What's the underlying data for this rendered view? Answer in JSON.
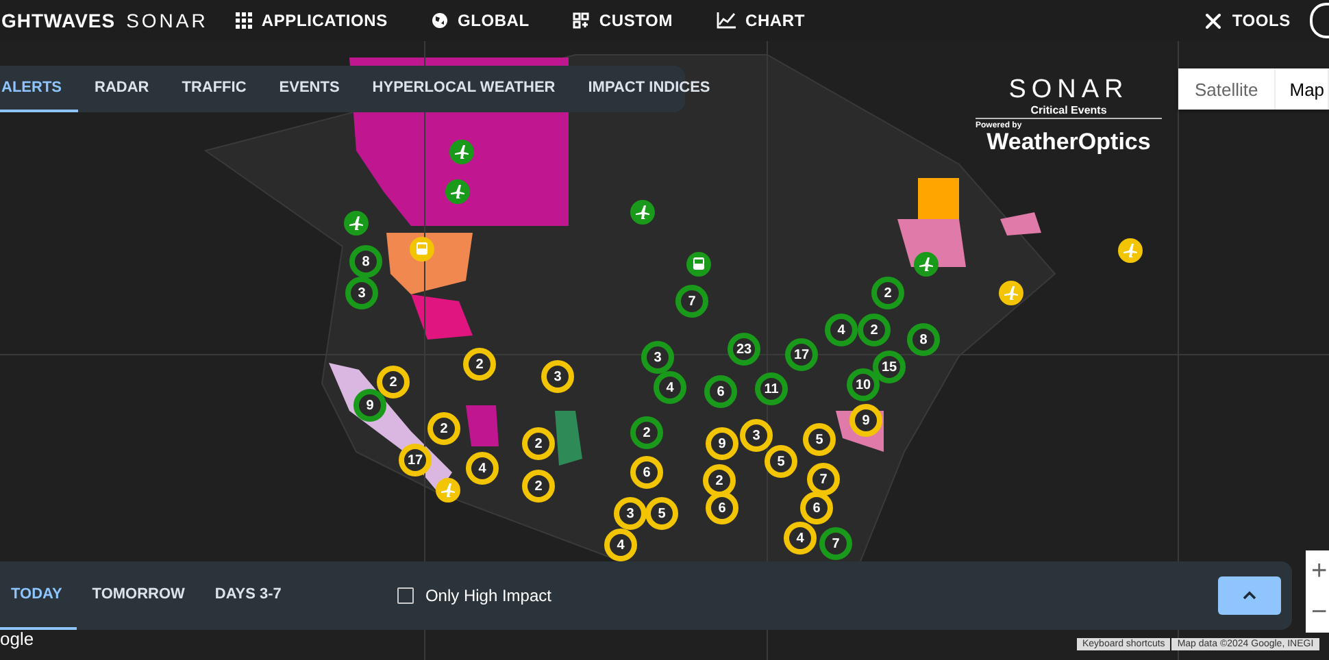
{
  "brand": {
    "name": "GHTWAVES",
    "product": "SONAR"
  },
  "nav": [
    {
      "label": "APPLICATIONS"
    },
    {
      "label": "GLOBAL"
    },
    {
      "label": "CUSTOM"
    },
    {
      "label": "CHART"
    }
  ],
  "tools": {
    "label": "TOOLS"
  },
  "tabs": [
    {
      "label": "ALERTS",
      "selected": true
    },
    {
      "label": "RADAR",
      "selected": false
    },
    {
      "label": "TRAFFIC",
      "selected": false
    },
    {
      "label": "EVENTS",
      "selected": false
    },
    {
      "label": "HYPERLOCAL WEATHER",
      "selected": false
    },
    {
      "label": "IMPACT INDICES",
      "selected": false
    }
  ],
  "logo": {
    "name": "SONAR",
    "subtitle": "Critical Events",
    "powered_by": "Powered by",
    "partner": "WeatherOptics"
  },
  "map_type": [
    {
      "label": "Satellite",
      "selected": false
    },
    {
      "label": "Map",
      "selected": true
    }
  ],
  "markers": [
    {
      "kind": "cluster",
      "count": "8",
      "color": "#1a9a1a"
    },
    {
      "kind": "cluster",
      "count": "3",
      "color": "#1a9a1a"
    },
    {
      "kind": "cluster",
      "count": "7",
      "color": "#1a9a1a"
    },
    {
      "kind": "cluster",
      "count": "2",
      "color": "#1a9a1a"
    },
    {
      "kind": "cluster",
      "count": "4",
      "color": "#1a9a1a"
    },
    {
      "kind": "cluster",
      "count": "2",
      "color": "#1a9a1a"
    },
    {
      "kind": "cluster",
      "count": "8",
      "color": "#1a9a1a"
    },
    {
      "kind": "cluster",
      "count": "23",
      "color": "#1a9a1a"
    },
    {
      "kind": "cluster",
      "count": "17",
      "color": "#1a9a1a"
    },
    {
      "kind": "cluster",
      "count": "15",
      "color": "#1a9a1a"
    },
    {
      "kind": "cluster",
      "count": "3",
      "color": "#1a9a1a"
    },
    {
      "kind": "cluster",
      "count": "4",
      "color": "#1a9a1a"
    },
    {
      "kind": "cluster",
      "count": "6",
      "color": "#1a9a1a"
    },
    {
      "kind": "cluster",
      "count": "11",
      "color": "#1a9a1a"
    },
    {
      "kind": "cluster",
      "count": "10",
      "color": "#1a9a1a"
    },
    {
      "kind": "cluster",
      "count": "2",
      "color": "#1a9a1a"
    },
    {
      "kind": "cluster",
      "count": "6",
      "color": "#f2c500"
    },
    {
      "kind": "cluster",
      "count": "9",
      "color": "#1a9a1a"
    },
    {
      "kind": "cluster",
      "count": "2",
      "color": "#f2c500"
    },
    {
      "kind": "cluster",
      "count": "3",
      "color": "#f2c500"
    },
    {
      "kind": "cluster",
      "count": "2",
      "color": "#f2c500"
    },
    {
      "kind": "cluster",
      "count": "2",
      "color": "#f2c500"
    },
    {
      "kind": "cluster",
      "count": "2",
      "color": "#f2c500"
    },
    {
      "kind": "cluster",
      "count": "17",
      "color": "#f2c500"
    },
    {
      "kind": "cluster",
      "count": "4",
      "color": "#f2c500"
    },
    {
      "kind": "cluster",
      "count": "2",
      "color": "#f2c500"
    },
    {
      "kind": "cluster",
      "count": "9",
      "color": "#f2c500"
    },
    {
      "kind": "cluster",
      "count": "3",
      "color": "#f2c500"
    },
    {
      "kind": "cluster",
      "count": "5",
      "color": "#f2c500"
    },
    {
      "kind": "cluster",
      "count": "9",
      "color": "#f2c500"
    },
    {
      "kind": "cluster",
      "count": "5",
      "color": "#f2c500"
    },
    {
      "kind": "cluster",
      "count": "2",
      "color": "#f2c500"
    },
    {
      "kind": "cluster",
      "count": "7",
      "color": "#f2c500"
    },
    {
      "kind": "cluster",
      "count": "6",
      "color": "#f2c500"
    },
    {
      "kind": "cluster",
      "count": "6",
      "color": "#f2c500"
    },
    {
      "kind": "cluster",
      "count": "3",
      "color": "#f2c500"
    },
    {
      "kind": "cluster",
      "count": "5",
      "color": "#f2c500"
    },
    {
      "kind": "cluster",
      "count": "4",
      "color": "#f2c500"
    },
    {
      "kind": "cluster",
      "count": "4",
      "color": "#f2c500"
    },
    {
      "kind": "cluster",
      "count": "7",
      "color": "#1a9a1a"
    },
    {
      "kind": "plane",
      "color": "#1a9a1a"
    },
    {
      "kind": "plane",
      "color": "#1a9a1a"
    },
    {
      "kind": "plane",
      "color": "#1a9a1a"
    },
    {
      "kind": "plane",
      "color": "#1a9a1a"
    },
    {
      "kind": "plane",
      "color": "#1a9a1a"
    },
    {
      "kind": "plane",
      "color": "#f2c500"
    },
    {
      "kind": "plane",
      "color": "#f2c500"
    },
    {
      "kind": "plane",
      "color": "#f2c500"
    },
    {
      "kind": "bus",
      "color": "#f2c500"
    },
    {
      "kind": "bus",
      "color": "#1a9a1a"
    }
  ],
  "days": [
    {
      "label": "TODAY",
      "selected": true
    },
    {
      "label": "TOMORROW",
      "selected": false
    },
    {
      "label": "DAYS 3-7",
      "selected": false
    }
  ],
  "high_impact": {
    "label": "Only High Impact",
    "checked": false
  },
  "zoom": [
    "+",
    "−"
  ],
  "attribution": {
    "google": "ogle",
    "shortcuts": "Keyboard shortcuts",
    "map_data": "Map data ©2024 Google, INEGI"
  }
}
